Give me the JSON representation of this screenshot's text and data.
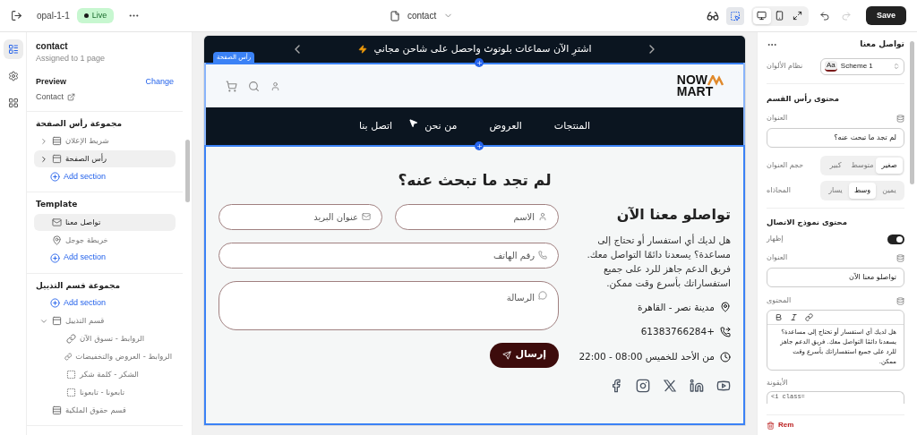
{
  "topbar": {
    "store": "opal-1-1",
    "status": "Live",
    "page": "contact",
    "devices": [
      {
        "kind": "desktop",
        "selected": true
      },
      {
        "kind": "mobile",
        "selected": false
      },
      {
        "kind": "fullscreen",
        "selected": false
      }
    ],
    "inspector_on": true,
    "save": "Save"
  },
  "rail": [
    {
      "kind": "sections",
      "selected": true
    },
    {
      "kind": "settings",
      "selected": false
    },
    {
      "kind": "apps",
      "selected": false
    }
  ],
  "template": {
    "title": "contact",
    "subtitle": "Assigned to 1 page",
    "preview_label": "Preview",
    "preview_value": "Contact",
    "change": "Change"
  },
  "groups": [
    {
      "title": "مجموعة رأس الصفحة",
      "add": "Add section",
      "items": [
        {
          "label": "شريط الإعلان",
          "kind": "announcement",
          "expanded": false,
          "selected": false
        },
        {
          "label": "رأس الصفحة",
          "kind": "header",
          "expanded": false,
          "selected": true
        }
      ]
    },
    {
      "title": "Template",
      "add": "Add section",
      "items": [
        {
          "label": "تواصل معنا",
          "kind": "contact",
          "selected": true
        },
        {
          "label": "خريطة جوجل",
          "kind": "map",
          "selected": false
        }
      ]
    },
    {
      "title": "مجموعة قسم التذييل",
      "add_top": "Add section",
      "items": [
        {
          "label": "قسم التذييل",
          "kind": "footer",
          "expanded": true,
          "selected": false,
          "children": [
            {
              "label": "الروابط - تسوق الآن",
              "kind": "link",
              "selected": false
            },
            {
              "label": "الروابط - العروض والتخفيضات",
              "kind": "link",
              "selected": false
            },
            {
              "label": "الشكر - كلمة شكر",
              "kind": "block",
              "selected": false
            },
            {
              "label": "تابعونا - تابعونا",
              "kind": "block",
              "selected": false
            }
          ]
        },
        {
          "label": "قسم حقوق الملكية",
          "kind": "announcement",
          "selected": false
        }
      ]
    }
  ],
  "preview": {
    "announcement": "اشترِ الآن سماعات بلوتوث واحصل على شاحن مجاني",
    "section_badge": "رأس الصفحة",
    "logo": {
      "line1": "NOW",
      "line2": "MART"
    },
    "nav": [
      "المنتجات",
      "العروض",
      "من نحن",
      "اتصل بنا"
    ],
    "contact": {
      "heading": "لم تجد ما تبحث عنه؟",
      "info_title": "تواصلو معنا الآن",
      "info_text": "هل لديك أي استفسار أو تحتاج إلى مساعدة؟ يسعدنا دائمًا التواصل معك. فريق الدعم جاهز للرد على جميع استفساراتك بأسرع وقت ممكن.",
      "details": [
        {
          "kind": "location",
          "text": "مدينة نصر - القاهرة"
        },
        {
          "kind": "phone",
          "text": "+61383766284"
        },
        {
          "kind": "clock",
          "text": "من الأحد للخميس 08:00 - 22:00"
        }
      ],
      "socials": [
        {
          "kind": "youtube"
        },
        {
          "kind": "linkedin"
        },
        {
          "kind": "x"
        },
        {
          "kind": "instagram"
        },
        {
          "kind": "facebook"
        }
      ],
      "fields": [
        {
          "kind": "name",
          "placeholder": "الاسم"
        },
        {
          "kind": "email",
          "placeholder": "عنوان البريد"
        },
        {
          "kind": "phone",
          "placeholder": "رقم الهاتف"
        },
        {
          "kind": "message",
          "placeholder": "الرسالة"
        }
      ],
      "send": "إرسال"
    }
  },
  "settings": {
    "title": "تواصل معنا",
    "scheme_label": "نظام الألوان",
    "scheme_value": "Scheme 1",
    "scheme_swatch": "Aa",
    "heading_section": "محتوى رأس القسم",
    "heading_label": "العنوان",
    "heading_value": "لم تجد ما تبحث عنه؟",
    "size_label": "حجم العنوان",
    "sizes": [
      {
        "label": "صغير",
        "selected": true
      },
      {
        "label": "متوسط",
        "selected": false
      },
      {
        "label": "كبير",
        "selected": false
      }
    ],
    "align_label": "المحاذاه",
    "aligns": [
      {
        "label": "يمين",
        "selected": false
      },
      {
        "label": "وسط",
        "selected": true
      },
      {
        "label": "يسار",
        "selected": false
      }
    ],
    "form_section": "محتوى نموذج الاتصال",
    "show_label": "إظهار",
    "show_on": true,
    "title_label": "العنوان",
    "title_value": "تواصلو معنا الآن",
    "content_label": "المحتوى",
    "content_value": "هل لديك أي استفسار أو تحتاج إلى مساعدة؟ يسعدنا دائمًا التواصل معك. فريق الدعم جاهز للرد على جميع استفساراتك بأسرع وقت ممكن.",
    "icon_label": "الأيقونة",
    "icon_value": "<i class=",
    "remove": "Rem"
  }
}
